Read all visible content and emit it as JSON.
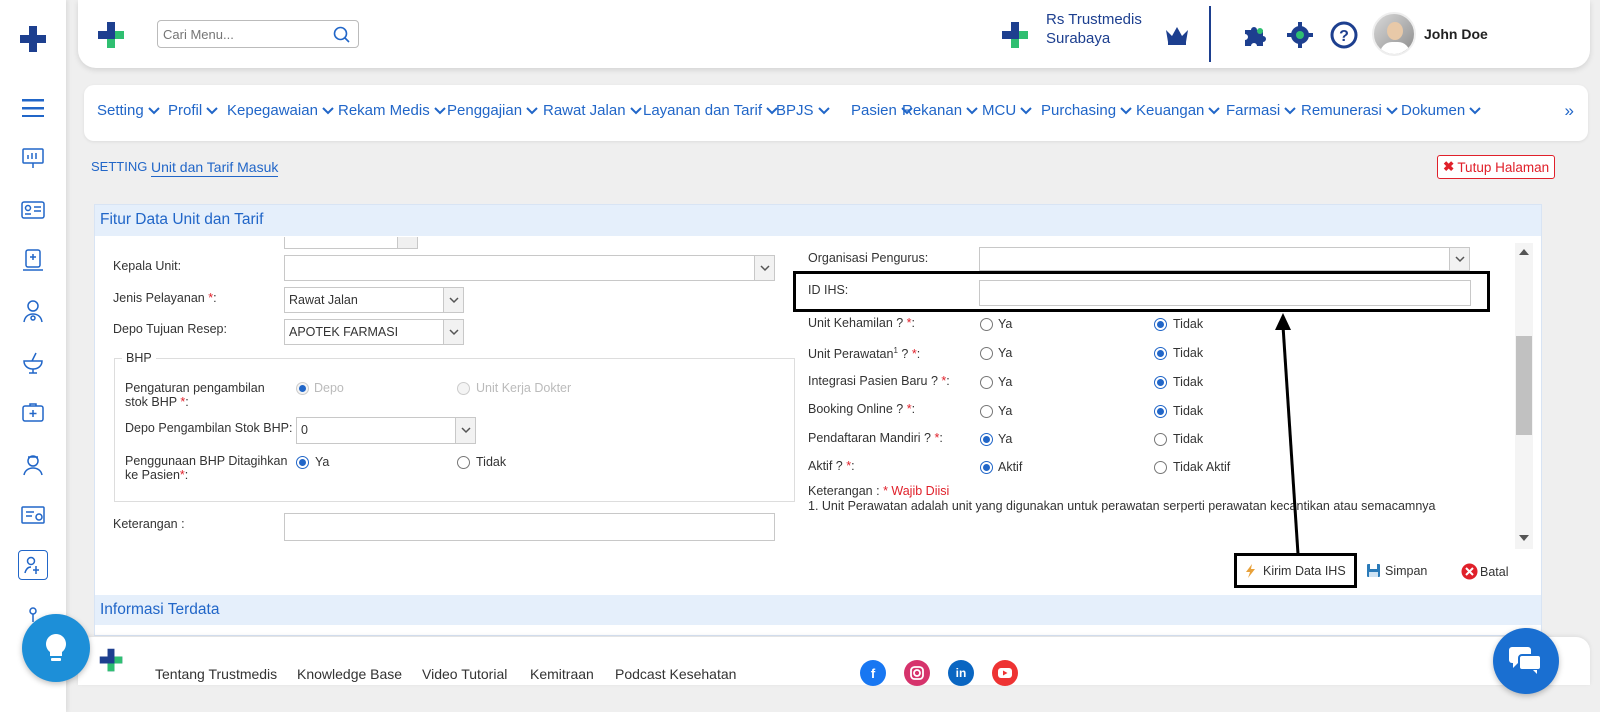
{
  "header": {
    "search_placeholder": "Cari Menu...",
    "hospital_line1": "Rs Trustmedis",
    "hospital_line2": "Surabaya",
    "user_name": "John Doe"
  },
  "menu": {
    "items": [
      "Setting",
      "Profil",
      "Kepegawaian",
      "Rekam Medis",
      "Penggajian",
      "Rawat Jalan",
      "Layanan dan Tarif",
      "BPJS",
      "Pasien",
      "Rekanan",
      "MCU",
      "Purchasing",
      "Keuangan",
      "Farmasi",
      "Remunerasi",
      "Dokumen"
    ],
    "more": "»"
  },
  "breadcrumb": {
    "root": "SETTING",
    "current": "Unit dan Tarif Masuk"
  },
  "close_page": "Tutup Halaman",
  "panel_title": "Fitur Data Unit dan Tarif",
  "left_form": {
    "kepala_unit_label": "Kepala Unit:",
    "kepala_unit_value": "",
    "jenis_pelayanan_label": "Jenis Pelayanan ",
    "jenis_pelayanan_value": "Rawat Jalan",
    "depo_tujuan_label": "Depo Tujuan Resep:",
    "depo_tujuan_value": "APOTEK FARMASI",
    "bhp_legend": "BHP",
    "pengaturan_label_1": "Pengaturan pengambilan",
    "pengaturan_label_2": "stok BHP ",
    "opt_depo": "Depo",
    "opt_unit_kerja": "Unit Kerja Dokter",
    "depo_pengambilan_label": "Depo Pengambilan Stok BHP:",
    "depo_pengambilan_value": "0",
    "penggunaan_label_1": "Penggunaan BHP Ditagihkan",
    "penggunaan_label_2": "ke Pasien",
    "opt_ya": "Ya",
    "opt_tidak": "Tidak",
    "keterangan_label": "Keterangan :",
    "keterangan_value": ""
  },
  "right_form": {
    "organisasi_label": "Organisasi Pengurus:",
    "organisasi_value": "",
    "id_ihs_label": "ID IHS:",
    "id_ihs_value": "",
    "unit_kehamilan_label": "Unit Kehamilan ? ",
    "unit_perawatan_label": "Unit Perawatan",
    "unit_perawatan_sup": "1",
    "integrasi_label": "Integrasi Pasien Baru ? ",
    "booking_label": "Booking Online ? ",
    "pendaftaran_label": "Pendaftaran Mandiri ? ",
    "aktif_label": "Aktif ? ",
    "opt_ya": "Ya",
    "opt_tidak": "Tidak",
    "opt_aktif": "Aktif",
    "opt_tidak_aktif": "Tidak Aktif",
    "note_prefix": "Keterangan : ",
    "note_required": "* Wajib Diisi",
    "note_1": "1. Unit Perawatan adalah unit yang digunakan untuk perawatan serperti perawatan kecantikan atau semacamnya"
  },
  "actions": {
    "kirim": "Kirim Data IHS",
    "simpan": "Simpan",
    "batal": "Batal"
  },
  "informasi_title": "Informasi Terdata",
  "footer": {
    "links": [
      "Tentang Trustmedis",
      "Knowledge Base",
      "Video Tutorial",
      "Kemitraan",
      "Podcast Kesehatan"
    ]
  },
  "colors": {
    "brand_blue": "#2166c8",
    "brand_green": "#2fbf71",
    "annotation": "#000000"
  }
}
